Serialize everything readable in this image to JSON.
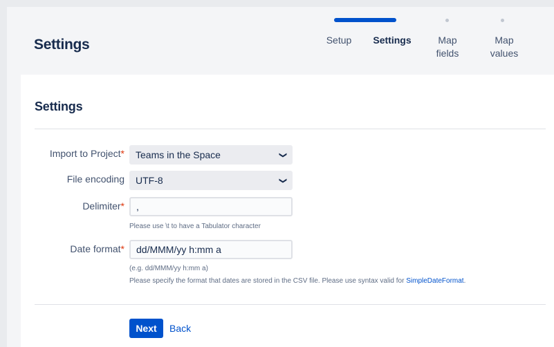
{
  "header": {
    "title": "Settings",
    "steps": [
      {
        "label": "Setup",
        "state": "done"
      },
      {
        "label": "Settings",
        "state": "current"
      },
      {
        "label": "Map fields",
        "state": "upcoming"
      },
      {
        "label": "Map values",
        "state": "upcoming"
      }
    ],
    "progress_color": "#0052cc"
  },
  "panel": {
    "title": "Settings",
    "fields": {
      "project": {
        "label": "Import to Project",
        "required": "*",
        "value": "Teams in the Space",
        "icon": "chevron-down-icon"
      },
      "encoding": {
        "label": "File encoding",
        "value": "UTF-8",
        "icon": "chevron-down-icon"
      },
      "delimiter": {
        "label": "Delimiter",
        "required": "*",
        "value": ",",
        "help": "Please use \\t to have a Tabulator character"
      },
      "date_format": {
        "label": "Date format",
        "required": "*",
        "value": "dd/MMM/yy h:mm a",
        "example": "(e.g. dd/MMM/yy h:mm a)",
        "help_prefix": "Please specify the format that dates are stored in the CSV file. Please use syntax valid for ",
        "help_link": "SimpleDateFormat",
        "help_suffix": "."
      }
    },
    "actions": {
      "next": "Next",
      "back": "Back"
    }
  }
}
